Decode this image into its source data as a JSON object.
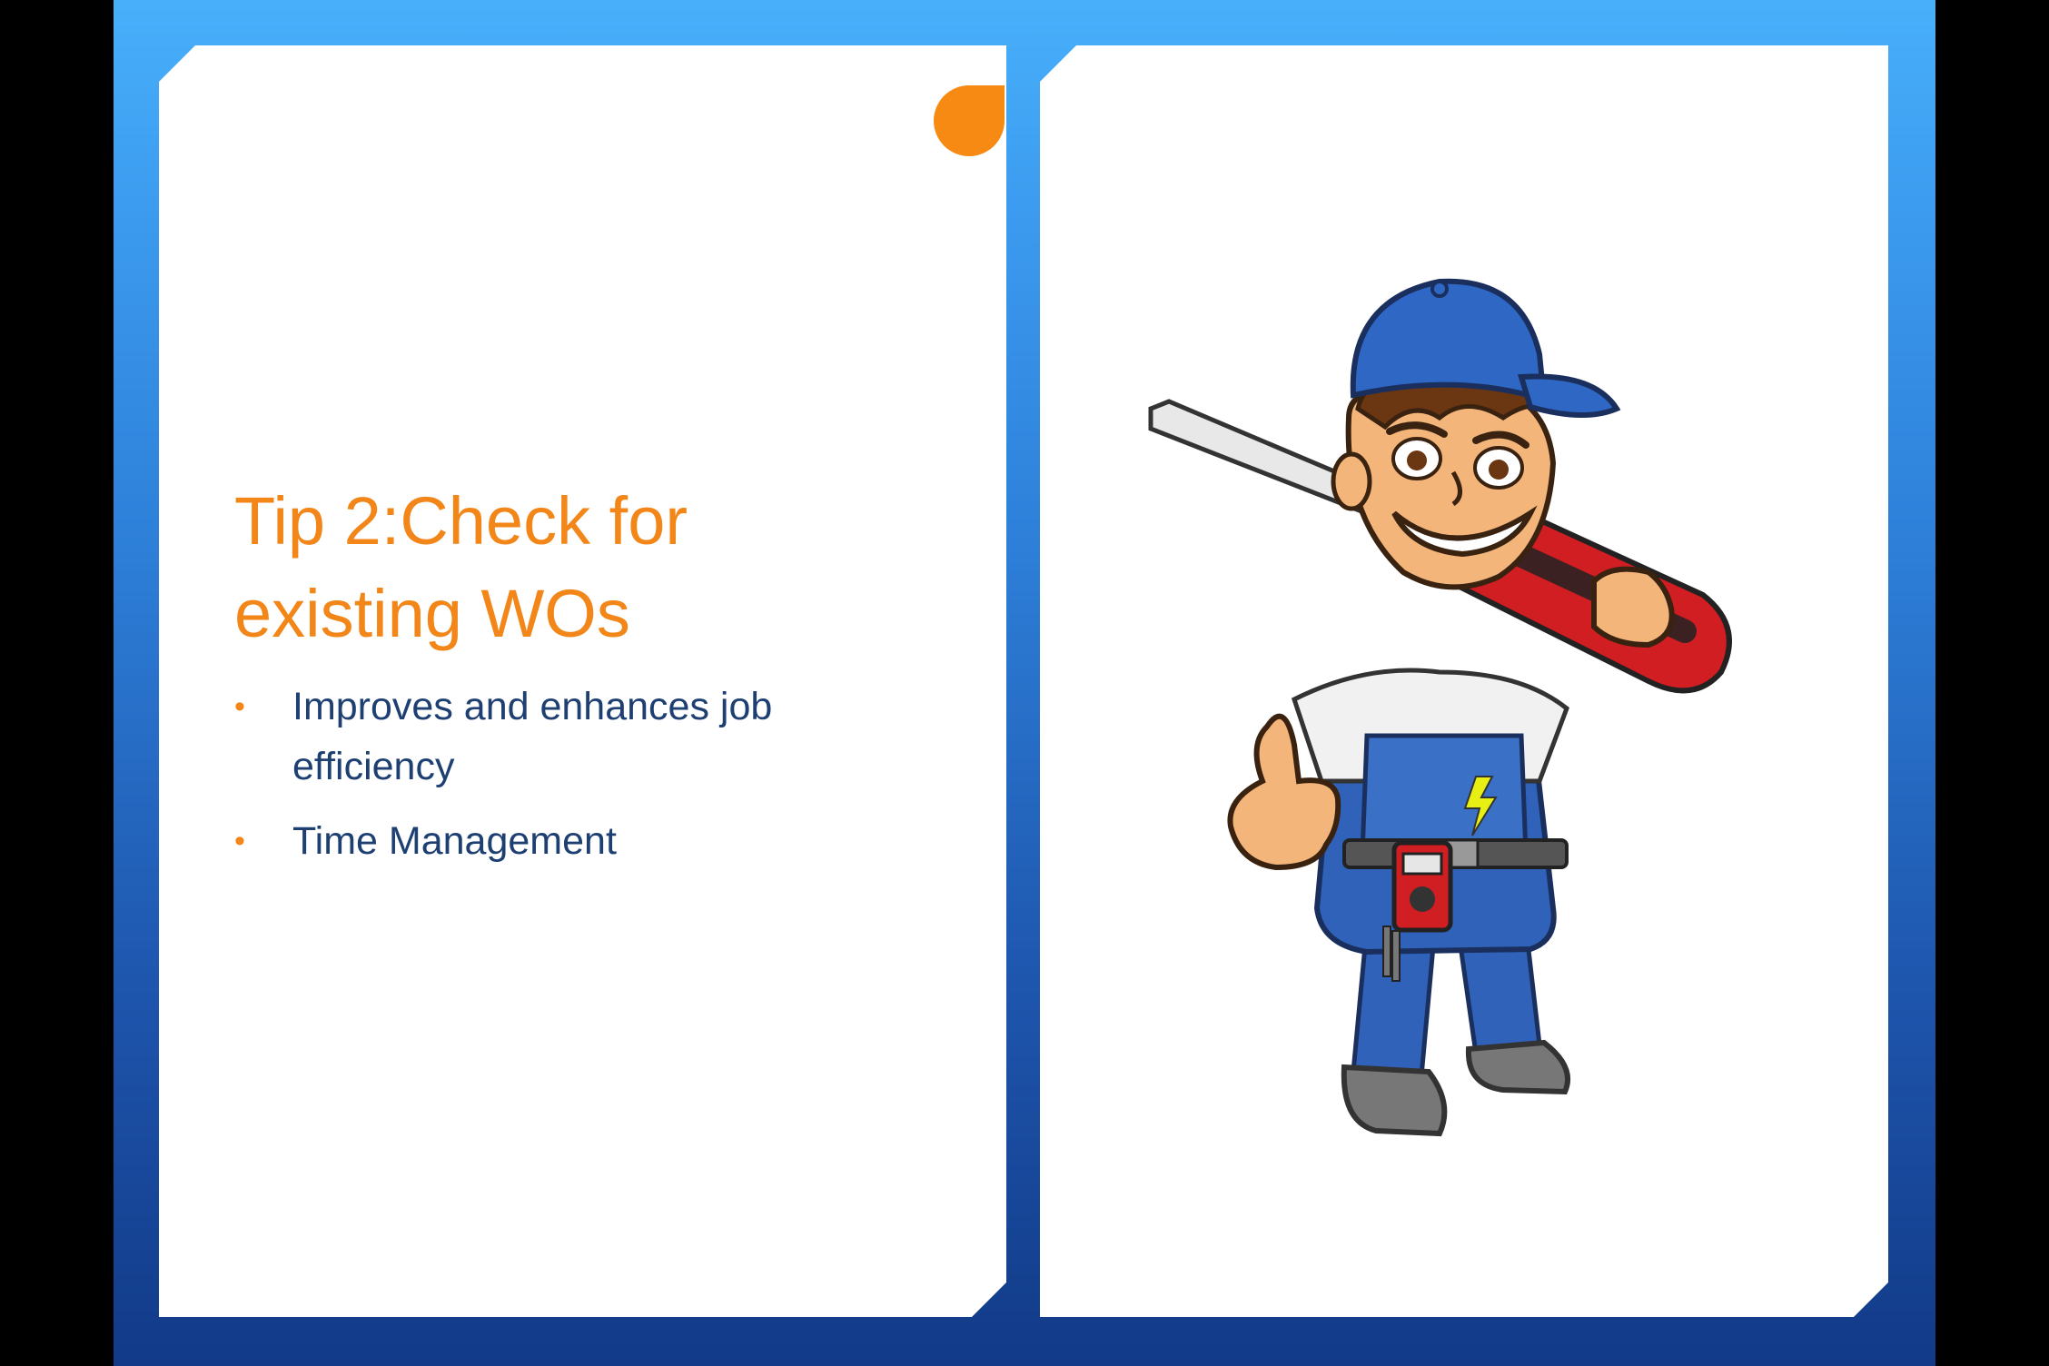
{
  "slide": {
    "title": "Tip 2:Check for existing WOs",
    "bullets": [
      "Improves and enhances job efficiency",
      "Time Management"
    ]
  },
  "colors": {
    "background_top": "#48b0fb",
    "background_bottom": "#123a88",
    "title": "#f28619",
    "body_text": "#1e3f72",
    "accent": "#f78a12",
    "panel": "#ffffff"
  },
  "illustration": {
    "subject": "technician-with-screwdriver"
  }
}
